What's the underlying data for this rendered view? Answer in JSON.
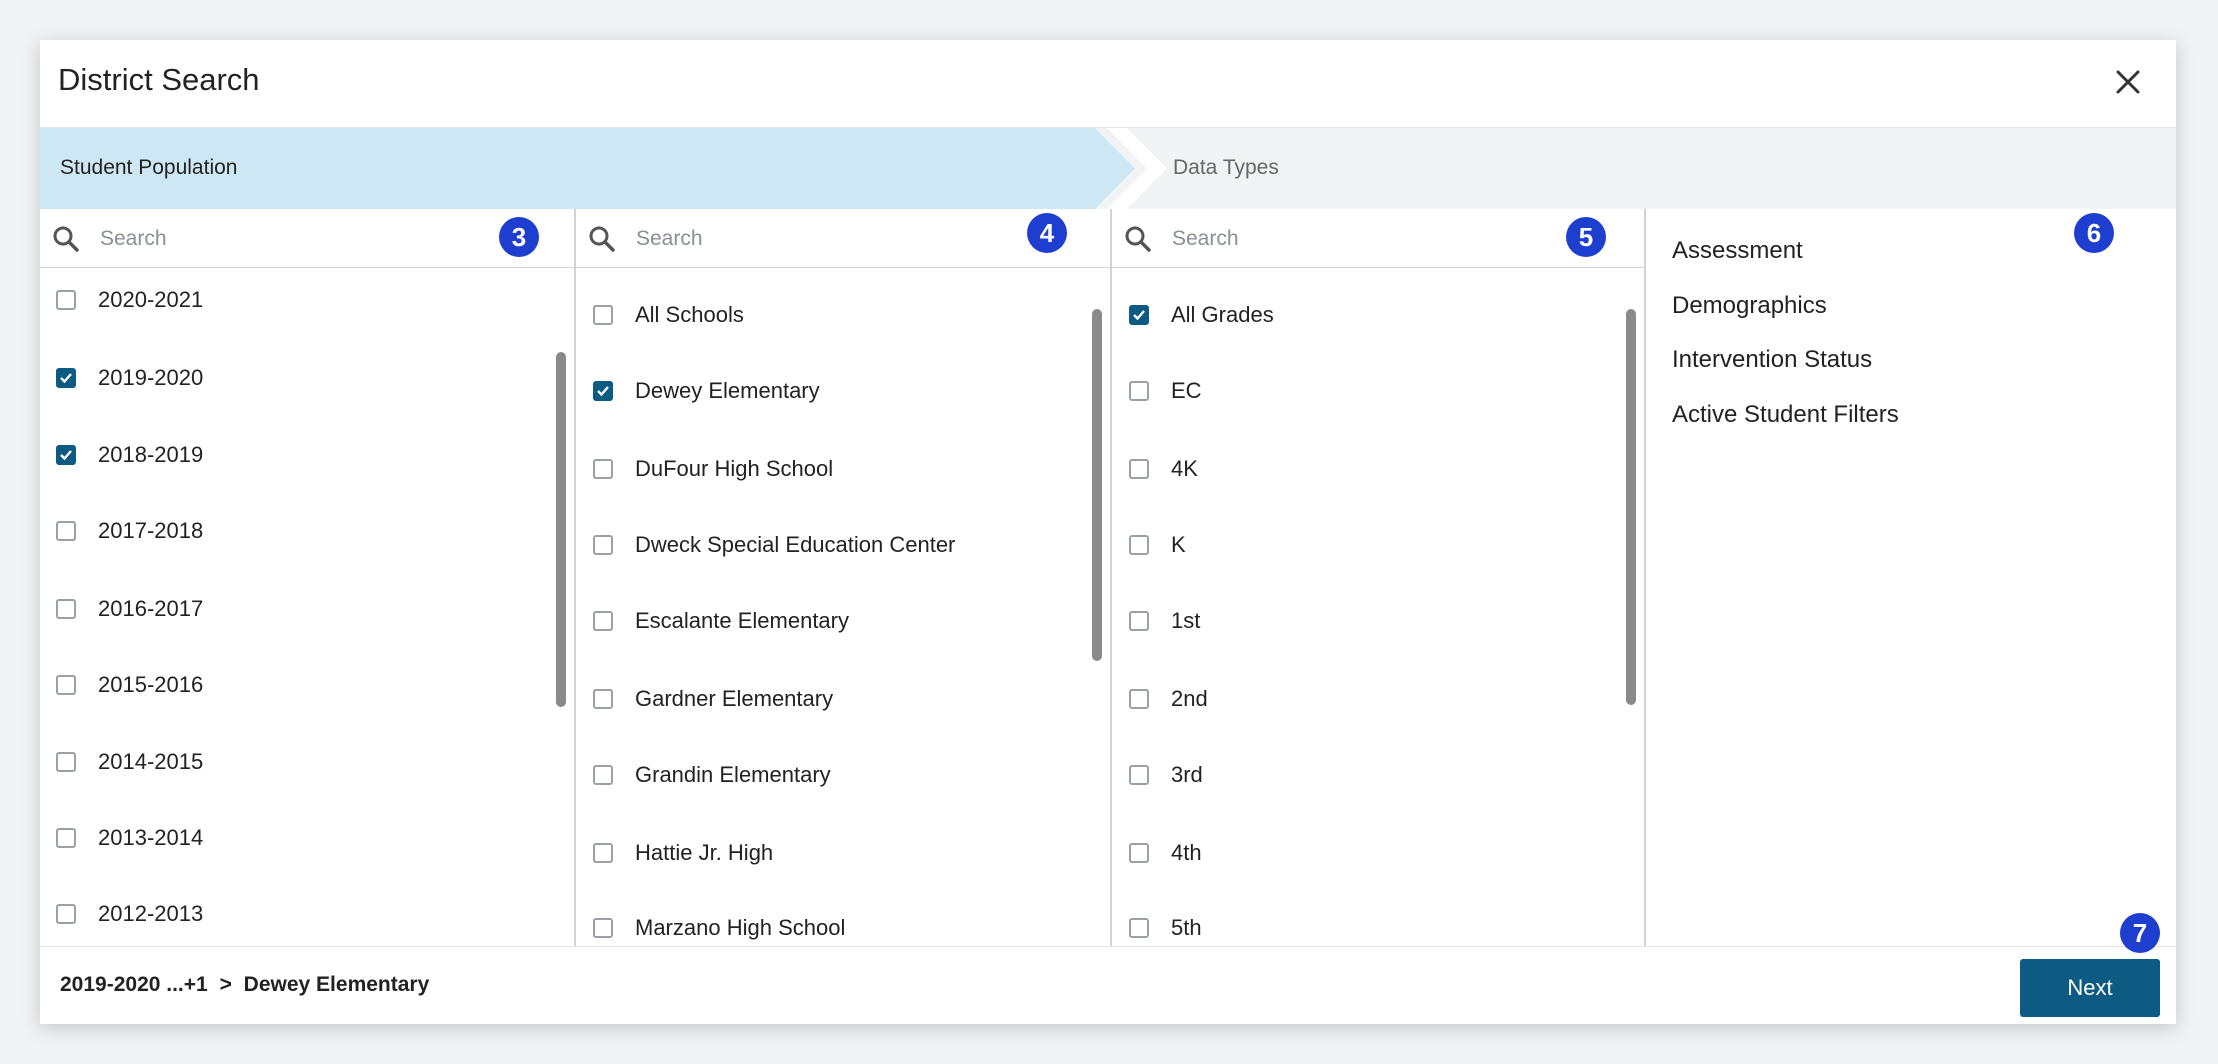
{
  "dialog": {
    "title": "District Search"
  },
  "steps": [
    {
      "label": "Student Population",
      "active": true
    },
    {
      "label": "Data Types",
      "active": false
    }
  ],
  "columns": {
    "years": {
      "placeholder": "Search",
      "badge": "3",
      "items": [
        {
          "label": "2020-2021",
          "checked": false
        },
        {
          "label": "2019-2020",
          "checked": true
        },
        {
          "label": "2018-2019",
          "checked": true
        },
        {
          "label": "2017-2018",
          "checked": false
        },
        {
          "label": "2016-2017",
          "checked": false
        },
        {
          "label": "2015-2016",
          "checked": false
        },
        {
          "label": "2014-2015",
          "checked": false
        },
        {
          "label": "2013-2014",
          "checked": false
        },
        {
          "label": "2012-2013",
          "checked": false
        }
      ]
    },
    "schools": {
      "placeholder": "Search",
      "badge": "4",
      "items": [
        {
          "label": "All Schools",
          "checked": false
        },
        {
          "label": "Dewey Elementary",
          "checked": true
        },
        {
          "label": "DuFour High School",
          "checked": false
        },
        {
          "label": "Dweck Special Education Center",
          "checked": false
        },
        {
          "label": "Escalante Elementary",
          "checked": false
        },
        {
          "label": "Gardner Elementary",
          "checked": false
        },
        {
          "label": "Grandin Elementary",
          "checked": false
        },
        {
          "label": "Hattie Jr. High",
          "checked": false
        },
        {
          "label": "Marzano High School",
          "checked": false
        }
      ]
    },
    "grades": {
      "placeholder": "Search",
      "badge": "5",
      "items": [
        {
          "label": "All Grades",
          "checked": true
        },
        {
          "label": "EC",
          "checked": false
        },
        {
          "label": "4K",
          "checked": false
        },
        {
          "label": "K",
          "checked": false
        },
        {
          "label": "1st",
          "checked": false
        },
        {
          "label": "2nd",
          "checked": false
        },
        {
          "label": "3rd",
          "checked": false
        },
        {
          "label": "4th",
          "checked": false
        },
        {
          "label": "5th",
          "checked": false
        }
      ]
    }
  },
  "data_types": {
    "badge": "6",
    "items": [
      {
        "label": "Assessment"
      },
      {
        "label": "Demographics"
      },
      {
        "label": "Intervention Status"
      },
      {
        "label": "Active Student Filters"
      }
    ]
  },
  "footer": {
    "breadcrumb": [
      "2019-2020 ...+1",
      ">",
      "Dewey Elementary"
    ],
    "badge": "7",
    "next_label": "Next"
  },
  "colors": {
    "accent": "#0d5a82",
    "badge": "#1d3ecf",
    "active_step": "#cde8f4"
  }
}
